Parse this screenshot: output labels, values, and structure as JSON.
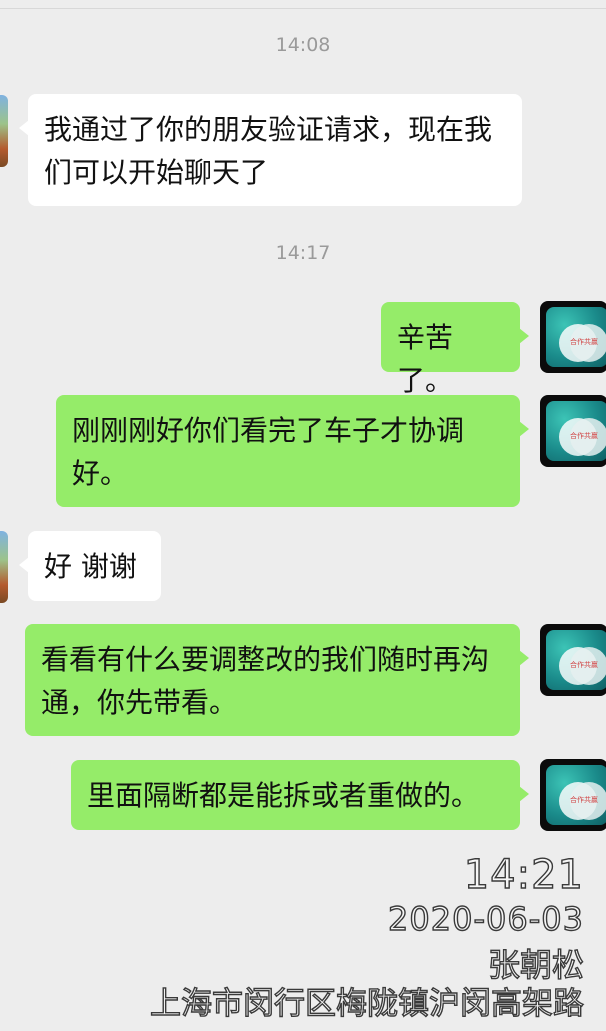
{
  "chat": {
    "timestamps": [
      "14:08",
      "14:17"
    ],
    "messages": [
      {
        "side": "left",
        "text": "我通过了你的朋友验证请求，现在我们可以开始聊天了"
      },
      {
        "side": "right",
        "text": "辛苦了。"
      },
      {
        "side": "right",
        "text": "刚刚刚好你们看完了车子才协调好。"
      },
      {
        "side": "left",
        "text": "好 谢谢"
      },
      {
        "side": "right",
        "text": "看看有什么要调整改的我们随时再沟通，你先带看。"
      },
      {
        "side": "right",
        "text": "里面隔断都是能拆或者重做的。"
      }
    ],
    "self_avatar_tag": "合作共赢"
  },
  "watermark": {
    "time": "14:21",
    "date": "2020-06-03",
    "name": "张朝松",
    "address": "上海市闵行区梅陇镇沪闵高架路"
  },
  "colors": {
    "background": "#ededed",
    "self_bubble": "#95ec69",
    "other_bubble": "#ffffff"
  }
}
